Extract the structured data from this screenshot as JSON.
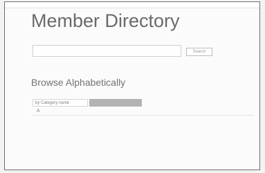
{
  "header": {
    "crumb": ""
  },
  "page": {
    "title": "Member Directory"
  },
  "search": {
    "button_label": "Search",
    "placeholder": "",
    "value": "",
    "link": ""
  },
  "browse": {
    "heading": "Browse Alphabetically",
    "tab_category_label": "by Category name",
    "tab_active_label": ""
  },
  "directory": {
    "letter": "A",
    "rows": [
      [
        "",
        "",
        ""
      ],
      [
        "",
        "",
        ""
      ],
      [
        "",
        "",
        ""
      ],
      [
        "",
        "",
        ""
      ]
    ]
  }
}
